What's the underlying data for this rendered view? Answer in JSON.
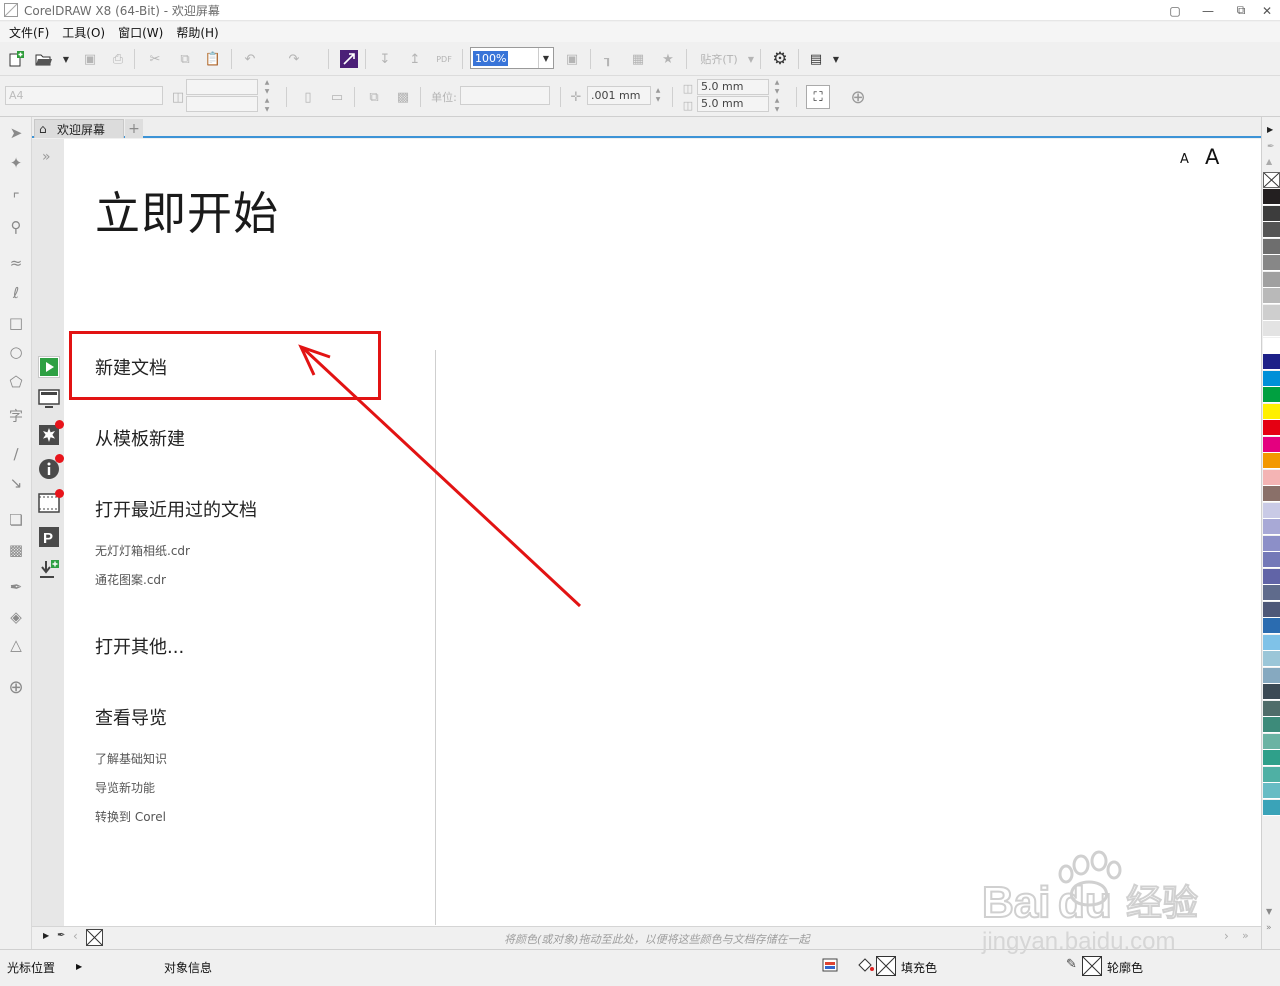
{
  "window": {
    "title": "CorelDRAW X8 (64-Bit) - 欢迎屏幕"
  },
  "menu": [
    "文件(F)",
    "工具(O)",
    "窗口(W)",
    "帮助(H)"
  ],
  "toolbar": {
    "zoom_value": "100%",
    "snap_label": "贴齐(T)",
    "pdf_label": "PDF"
  },
  "property_bar": {
    "page_size": "A4",
    "units_label": "单位:",
    "nudge": ".001 mm",
    "dup_x": "5.0 mm",
    "dup_y": "5.0 mm"
  },
  "tabs": {
    "welcome": "欢迎屏幕",
    "add": "+"
  },
  "welcome": {
    "font_small": "A",
    "font_large": "A",
    "title": "立即开始",
    "new_doc": "新建文档",
    "from_template": "从模板新建",
    "open_recent": "打开最近用过的文档",
    "recent_files": [
      "无灯灯箱相纸.cdr",
      "通花图案.cdr"
    ],
    "open_other": "打开其他...",
    "tour": "查看导览",
    "tour_links": [
      "了解基础知识",
      "导览新功能",
      "转换到 Corel"
    ]
  },
  "document_palette": {
    "hint": "将颜色(或对象)拖动至此处，以便将这些颜色与文档存储在一起"
  },
  "status_bar": {
    "cursor_position": "光标位置",
    "object_info": "对象信息",
    "fill_label": "填充色",
    "outline_label": "轮廓色"
  },
  "palette_colors": [
    "#231f20",
    "#3c3c3c",
    "#555555",
    "#6e6e6e",
    "#878787",
    "#a0a0a0",
    "#b9b9b9",
    "#cecece",
    "#e3e3e3",
    "#ffffff",
    "#1d2088",
    "#0090d8",
    "#00a040",
    "#fff000",
    "#e50012",
    "#e4007f",
    "#f39800",
    "#f4b4b4",
    "#8a7069",
    "#c9cae6",
    "#a8a9d6",
    "#8c8fc8",
    "#7479b8",
    "#6164a7",
    "#5f6b8c",
    "#4e5878",
    "#2b6cb0",
    "#7fc2e8",
    "#9bc6d8",
    "#86a9c0",
    "#3c4a55",
    "#506d6a",
    "#3d8b7a",
    "#6bb3a3",
    "#2fa08a",
    "#4fb0a4",
    "#67bcc4",
    "#3aa3b8"
  ],
  "colors": {
    "highlight": "#e21313",
    "tab_accent": "#3c93d6"
  }
}
